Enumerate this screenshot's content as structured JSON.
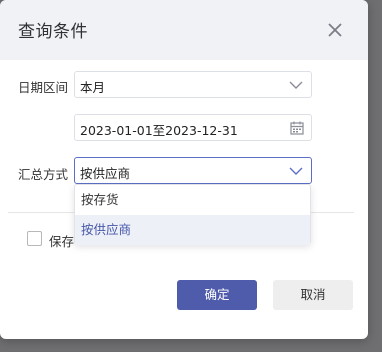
{
  "dialog": {
    "title": "查询条件",
    "close_icon": "close-icon"
  },
  "fields": {
    "date_label": "日期区间",
    "date_period_value": "本月",
    "date_range_value": "2023-01-01至2023-12-31",
    "summary_label": "汇总方式",
    "summary_value": "按供应商"
  },
  "dropdown": {
    "options": [
      "按存货",
      "按供应商"
    ],
    "selected": "按供应商"
  },
  "save_checkbox": {
    "label_visible": "保存",
    "checked": false
  },
  "buttons": {
    "ok": "确定",
    "cancel": "取消"
  },
  "colors": {
    "primary": "#4f5bab",
    "header_bg": "#f1f2f6",
    "selected_option_bg": "#eef0f8",
    "selected_option_text": "#4457a8"
  }
}
